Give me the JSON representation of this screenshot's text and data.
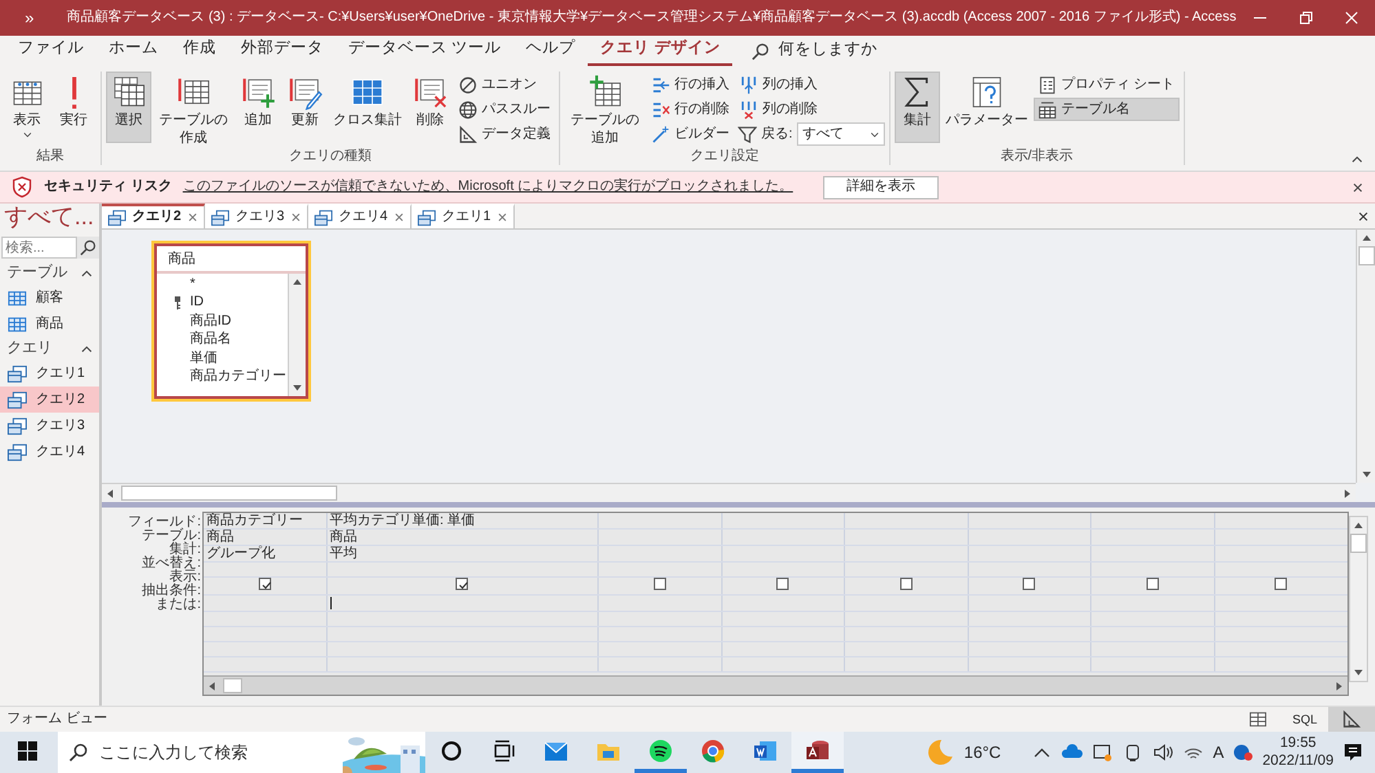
{
  "window": {
    "quick_access": "»",
    "title": "商品顧客データベース (3) : データベース- C:¥Users¥user¥OneDrive - 東京情報大学¥データベース管理システム¥商品顧客データベース (3).accdb (Access 2007 - 2016 ファイル形式) - Access"
  },
  "ribbon": {
    "tabs": [
      {
        "label": "ファイル",
        "selected": false
      },
      {
        "label": "ホーム",
        "selected": false
      },
      {
        "label": "作成",
        "selected": false
      },
      {
        "label": "外部データ",
        "selected": false
      },
      {
        "label": "データベース ツール",
        "selected": false
      },
      {
        "label": "ヘルプ",
        "selected": false
      },
      {
        "label": "クエリ デザイン",
        "selected": true
      }
    ],
    "tell_me": "何をしますか",
    "groups": [
      {
        "label": "結果",
        "items": [
          {
            "kind": "large",
            "label": "表示",
            "dropdown": true,
            "pressed": false
          },
          {
            "kind": "large",
            "label": "実行",
            "dropdown": false,
            "pressed": false
          }
        ]
      },
      {
        "label": "クエリの種類",
        "items": [
          {
            "kind": "large",
            "label": "選択",
            "dropdown": false,
            "pressed": true
          },
          {
            "kind": "large",
            "label": "テーブルの作成",
            "dropdown": false,
            "pressed": false
          },
          {
            "kind": "large",
            "label": "追加",
            "dropdown": false,
            "pressed": false
          },
          {
            "kind": "large",
            "label": "更新",
            "dropdown": false,
            "pressed": false
          },
          {
            "kind": "large",
            "label": "クロス集計",
            "dropdown": false,
            "pressed": false
          },
          {
            "kind": "large",
            "label": "削除",
            "dropdown": false,
            "pressed": false
          },
          {
            "kind": "stack",
            "items": [
              {
                "kind": "small",
                "label": "ユニオン",
                "pressed": false
              },
              {
                "kind": "small",
                "label": "パススルー",
                "pressed": false
              },
              {
                "kind": "small",
                "label": "データ定義",
                "pressed": false
              }
            ]
          }
        ]
      },
      {
        "label": "クエリ設定",
        "items": [
          {
            "kind": "large",
            "label": "テーブルの追加",
            "dropdown": false,
            "pressed": false
          },
          {
            "kind": "stack",
            "items": [
              {
                "kind": "small",
                "label": "行の挿入",
                "pressed": false
              },
              {
                "kind": "small",
                "label": "行の削除",
                "pressed": false
              },
              {
                "kind": "small",
                "label": "ビルダー",
                "pressed": false
              }
            ]
          },
          {
            "kind": "stack",
            "items": [
              {
                "kind": "small",
                "label": "列の挿入",
                "pressed": false
              },
              {
                "kind": "small",
                "label": "列の削除",
                "pressed": false
              },
              {
                "kind": "combo",
                "label": "戻る:",
                "value": "すべて"
              }
            ]
          }
        ]
      },
      {
        "label": "表示/非表示",
        "items": [
          {
            "kind": "large",
            "label": "集計",
            "dropdown": false,
            "pressed": true
          },
          {
            "kind": "large",
            "label": "パラメーター",
            "dropdown": false,
            "pressed": false
          },
          {
            "kind": "stack",
            "items": [
              {
                "kind": "small",
                "label": "プロパティ シート",
                "pressed": false
              },
              {
                "kind": "small",
                "label": "テーブル名",
                "pressed": true
              }
            ]
          }
        ]
      }
    ]
  },
  "security_bar": {
    "title": "セキュリティ リスク",
    "message": "このファイルのソースが信頼できないため、Microsoft によりマクロの実行がブロックされました。",
    "button": "詳細を表示"
  },
  "navigation": {
    "title": "すべて...",
    "search": {
      "placeholder": "検索..."
    },
    "groups": [
      {
        "label": "テーブル",
        "expanded": true,
        "items": [
          {
            "label": "顧客",
            "kind": "table",
            "selected": false
          },
          {
            "label": "商品",
            "kind": "table",
            "selected": false
          }
        ]
      },
      {
        "label": "クエリ",
        "expanded": true,
        "items": [
          {
            "label": "クエリ1",
            "kind": "query",
            "selected": false
          },
          {
            "label": "クエリ2",
            "kind": "query",
            "selected": true
          },
          {
            "label": "クエリ3",
            "kind": "query",
            "selected": false
          },
          {
            "label": "クエリ4",
            "kind": "query",
            "selected": false
          }
        ]
      }
    ]
  },
  "document_tabs": [
    {
      "label": "クエリ2",
      "selected": true
    },
    {
      "label": "クエリ3",
      "selected": false
    },
    {
      "label": "クエリ4",
      "selected": false
    },
    {
      "label": "クエリ1",
      "selected": false
    }
  ],
  "field_list": {
    "title": "商品",
    "fields": [
      {
        "name": "*",
        "primary_key": false
      },
      {
        "name": "ID",
        "primary_key": true
      },
      {
        "name": "商品ID",
        "primary_key": false
      },
      {
        "name": "商品名",
        "primary_key": false
      },
      {
        "name": "単価",
        "primary_key": false
      },
      {
        "name": "商品カテゴリー",
        "primary_key": false
      }
    ]
  },
  "query_grid": {
    "row_labels": [
      "フィールド:",
      "テーブル:",
      "集計:",
      "並べ替え:",
      "表示:",
      "抽出条件:",
      "または:"
    ],
    "columns": [
      {
        "field": "商品カテゴリー",
        "table": "商品",
        "total": "グループ化",
        "show": true,
        "focused": false
      },
      {
        "field": "平均カテゴリ単価: 単価",
        "table": "商品",
        "total": "平均",
        "show": true,
        "focused": true
      },
      {
        "show": false,
        "focused": false
      },
      {
        "show": false,
        "focused": false
      },
      {
        "show": false,
        "focused": false
      },
      {
        "show": false,
        "focused": false
      },
      {
        "show": false,
        "focused": false
      },
      {
        "show": false,
        "focused": false
      }
    ]
  },
  "status_bar": {
    "text": "フォーム ビュー",
    "views": [
      {
        "kind": "datasheet",
        "selected": false
      },
      {
        "kind": "sql",
        "label": "SQL",
        "selected": false
      },
      {
        "kind": "design",
        "selected": true
      }
    ]
  },
  "taskbar": {
    "search_placeholder": "ここに入力して検索",
    "apps": [
      {
        "kind": "cortana",
        "running": false,
        "active": false
      },
      {
        "kind": "taskview",
        "running": false,
        "active": false
      },
      {
        "kind": "mail",
        "running": false,
        "active": false
      },
      {
        "kind": "folder",
        "running": false,
        "active": false
      },
      {
        "kind": "music",
        "running": true,
        "active": false
      },
      {
        "kind": "browser",
        "running": false,
        "active": false
      },
      {
        "kind": "word",
        "running": false,
        "active": false
      },
      {
        "kind": "database",
        "running": true,
        "active": true
      }
    ],
    "weather": "16°C",
    "ime": "A",
    "time": "19:55",
    "date": "2022/11/09"
  }
}
